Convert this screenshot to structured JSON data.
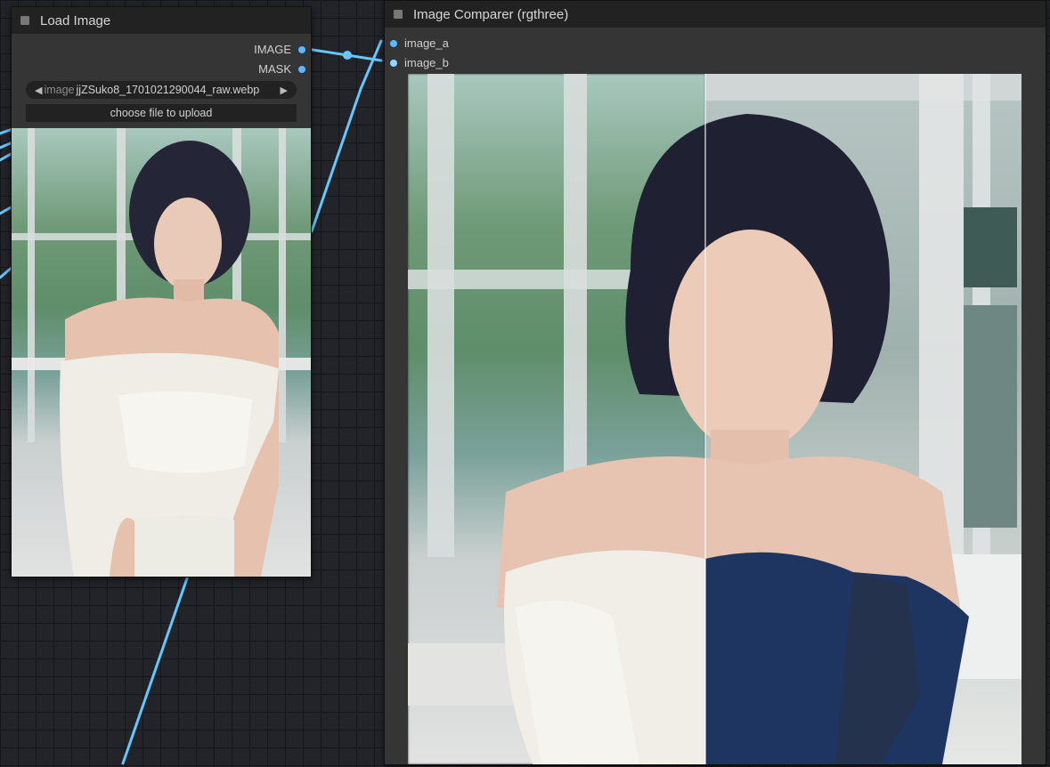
{
  "load_image_node": {
    "title": "Load Image",
    "outputs": [
      {
        "label": "IMAGE"
      },
      {
        "label": "MASK"
      }
    ],
    "image_combo": {
      "prefix": "image",
      "value": "jjZSuko8_1701021290044_raw.webp",
      "left_arrow": "◀",
      "right_arrow": "▶"
    },
    "upload_button": "choose file to upload"
  },
  "comparer_node": {
    "title": "Image Comparer (rgthree)",
    "inputs": [
      {
        "label": "image_a"
      },
      {
        "label": "image_b"
      }
    ]
  },
  "colors": {
    "wire": "#64c8ff",
    "slot": "#64b5f6",
    "node_bg": "#353535",
    "header_bg": "#222222",
    "canvas_bg": "#222429"
  }
}
